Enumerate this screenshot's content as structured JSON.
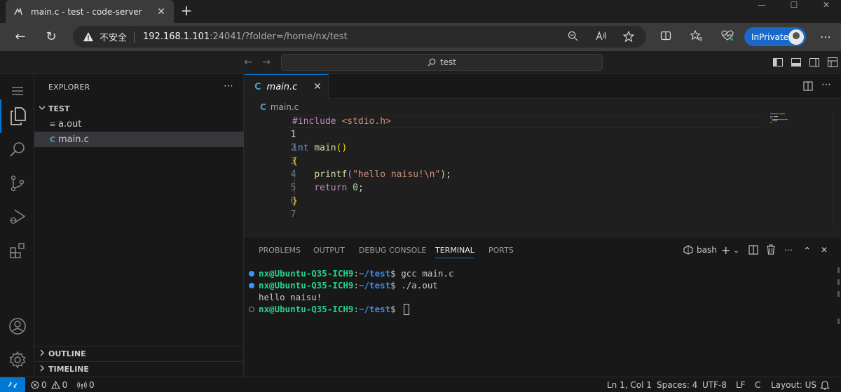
{
  "browser": {
    "tab_title": "main.c - test - code-server",
    "tab_close": "✕",
    "new_tab": "+",
    "window_controls": {
      "minimize": "—",
      "maximize": "☐",
      "close": "✕"
    },
    "back": "←",
    "reload": "↻",
    "security_label": "不安全",
    "url_host": "192.168.1.101",
    "url_rest": ":24041/?folder=/home/nx/test",
    "profile_label": "InPrivate",
    "more": "⋯"
  },
  "titlebar": {
    "back": "←",
    "forward": "→",
    "search_label": "test"
  },
  "explorer": {
    "title": "EXPLORER",
    "more": "⋯",
    "folder": "TEST",
    "files": [
      {
        "name": "a.out",
        "icon": "≡"
      },
      {
        "name": "main.c",
        "icon": "C"
      }
    ],
    "sections": [
      "OUTLINE",
      "TIMELINE"
    ]
  },
  "editor": {
    "tab_icon": "C",
    "tab_name": "main.c",
    "tab_close": "✕",
    "more": "⋯",
    "breadcrumb_icon": "C",
    "breadcrumb": "main.c",
    "line_numbers": [
      "1",
      "2",
      "3",
      "4",
      "5",
      "6",
      "7"
    ],
    "code": {
      "l1_pp": "#include",
      "l1_str": "<stdio.h>",
      "l3_kw": "int",
      "l3_fn": "main",
      "l3_paren": "()",
      "l4_brace": "{",
      "l5_fn": "printf",
      "l5_open": "(",
      "l5_str": "\"hello naisu!\\n\"",
      "l5_close": ");",
      "l6_kw": "return",
      "l6_num": "0",
      "l6_semi": ";",
      "l7_brace": "}"
    }
  },
  "panel": {
    "tabs": [
      "PROBLEMS",
      "OUTPUT",
      "DEBUG CONSOLE",
      "TERMINAL",
      "PORTS"
    ],
    "active_tab": "TERMINAL",
    "shell_label": "bash",
    "add": "+",
    "add_chevron": "⌄",
    "more": "⋯",
    "maximize": "⌃",
    "close": "✕",
    "terminal": {
      "user_host": "nx@Ubuntu-Q35-ICH9",
      "colon": ":",
      "path": "~/test",
      "prompt": "$ ",
      "cmd1": "gcc main.c",
      "cmd2": "./a.out",
      "output": "hello naisu!"
    }
  },
  "statusbar": {
    "remote": "⚡",
    "errors": "0",
    "warnings": "0",
    "ports": "0",
    "position": "Ln 1, Col 1",
    "spaces": "Spaces: 4",
    "encoding": "UTF-8",
    "eol": "LF",
    "language": "C",
    "layout": "Layout: US"
  },
  "colors": {
    "accent": "#0078d4",
    "inprivate": "#1a69c9",
    "c_icon": "#519aba"
  }
}
